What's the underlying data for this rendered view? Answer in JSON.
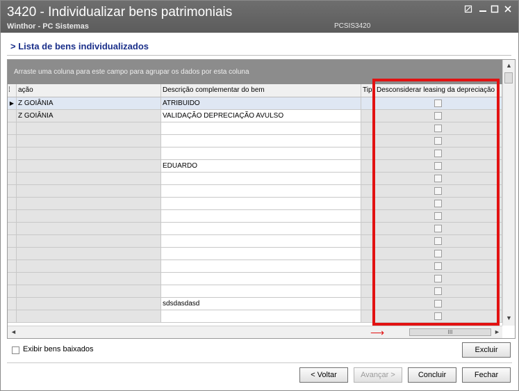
{
  "window": {
    "title": "3420 - Individualizar bens patrimoniais",
    "subtitle": "Winthor - PC Sistemas",
    "code": "PCSIS3420",
    "controls": [
      "minimize-icon",
      "maximize-icon",
      "close-icon"
    ]
  },
  "section_title": "> Lista de bens individualizados",
  "grid": {
    "group_hint": "Arraste uma coluna para este campo para agrupar os dados por esta coluna",
    "columns": [
      "ação",
      "Descrição complementar do bem",
      "Tip",
      "Desconsiderar leasing da depreciação"
    ],
    "rows": [
      {
        "loc": "Z GOIÂNIA",
        "desc": "ATRIBUIDO",
        "checked": false,
        "current": true
      },
      {
        "loc": "Z GOIÂNIA",
        "desc": "VALIDAÇÃO DEPRECIAÇÃO AVULSO",
        "checked": false,
        "current": false
      },
      {
        "loc": "",
        "desc": "",
        "checked": false,
        "current": false
      },
      {
        "loc": "",
        "desc": "",
        "checked": false,
        "current": false
      },
      {
        "loc": "",
        "desc": "",
        "checked": false,
        "current": false
      },
      {
        "loc": "",
        "desc": "EDUARDO",
        "checked": false,
        "current": false
      },
      {
        "loc": "",
        "desc": "",
        "checked": false,
        "current": false
      },
      {
        "loc": "",
        "desc": "",
        "checked": false,
        "current": false
      },
      {
        "loc": "",
        "desc": "",
        "checked": false,
        "current": false
      },
      {
        "loc": "",
        "desc": "",
        "checked": false,
        "current": false
      },
      {
        "loc": "",
        "desc": "",
        "checked": false,
        "current": false
      },
      {
        "loc": "",
        "desc": "",
        "checked": false,
        "current": false
      },
      {
        "loc": "",
        "desc": "",
        "checked": false,
        "current": false
      },
      {
        "loc": "",
        "desc": "",
        "checked": false,
        "current": false
      },
      {
        "loc": "",
        "desc": "",
        "checked": false,
        "current": false
      },
      {
        "loc": "",
        "desc": "",
        "checked": false,
        "current": false
      },
      {
        "loc": "",
        "desc": "sdsdasdasd",
        "checked": false,
        "current": false
      },
      {
        "loc": "",
        "desc": "",
        "checked": false,
        "current": false
      }
    ],
    "hscroll_grip": "III"
  },
  "footer": {
    "show_disposed_label": "Exibir bens baixados",
    "delete_label": "Excluir",
    "back_label": "< Voltar",
    "next_label": "Avançar >",
    "finish_label": "Concluir",
    "close_label": "Fechar"
  },
  "colors": {
    "titlebar": "#5f5f5f",
    "section_title": "#1a2f8a",
    "highlight": "#e21212"
  }
}
